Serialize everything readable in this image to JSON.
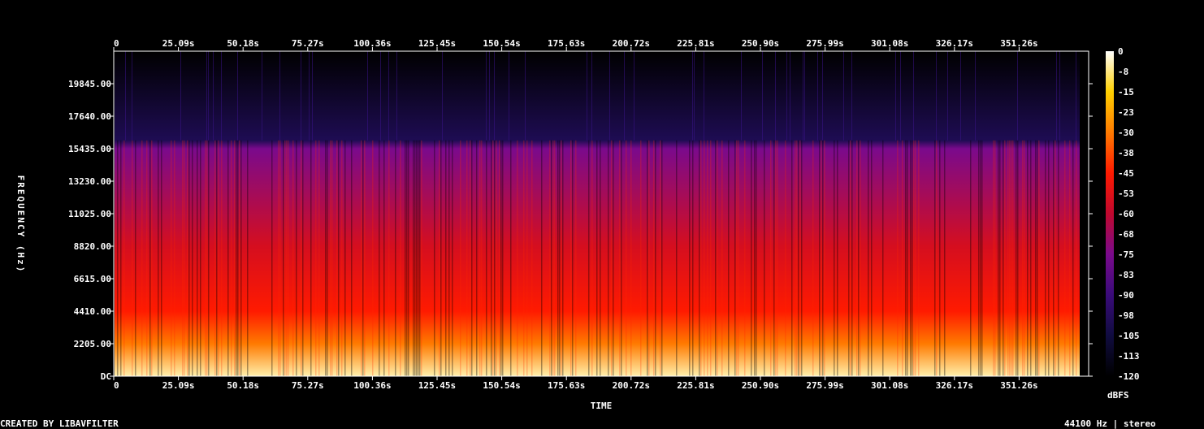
{
  "chart_data": {
    "type": "heatmap",
    "title": "",
    "xlabel": "TIME",
    "ylabel": "FREQUENCY (Hz)",
    "colorbar_label": "dBFS",
    "x_ticks": [
      "0",
      "25.09s",
      "50.18s",
      "75.27s",
      "100.36s",
      "125.45s",
      "150.54s",
      "175.63s",
      "200.72s",
      "225.81s",
      "250.90s",
      "275.99s",
      "301.08s",
      "326.17s",
      "351.26s"
    ],
    "y_ticks": [
      "DC",
      "2205.00",
      "4410.00",
      "6615.00",
      "8820.00",
      "11025.00",
      "13230.00",
      "15435.00",
      "17640.00",
      "19845.00"
    ],
    "colorbar_ticks": [
      "0",
      "-8",
      "-15",
      "-23",
      "-30",
      "-38",
      "-45",
      "-53",
      "-60",
      "-68",
      "-75",
      "-83",
      "-90",
      "-98",
      "-105",
      "-113",
      "-120"
    ],
    "xlim": [
      0,
      372
    ],
    "ylim": [
      0,
      22050
    ],
    "zlim": [
      -120,
      0
    ],
    "colormap_stops": [
      "#000000",
      "#100c40",
      "#3a0b7a",
      "#7a0a8c",
      "#c0082e",
      "#ff1a00",
      "#ff7a00",
      "#ffd000",
      "#ffffff"
    ],
    "energy_profile": {
      "bandwidth_cutoff_hz": 16000,
      "low_bands": [
        {
          "freq_hz": 0,
          "db": -5
        },
        {
          "freq_hz": 2205,
          "db": -30
        },
        {
          "freq_hz": 4410,
          "db": -45
        },
        {
          "freq_hz": 8820,
          "db": -55
        },
        {
          "freq_hz": 15435,
          "db": -75
        },
        {
          "freq_hz": 16000,
          "db": -100
        },
        {
          "freq_hz": 22050,
          "db": -120
        }
      ]
    }
  },
  "footer": {
    "created_by": "CREATED BY LIBAVFILTER",
    "info": "44100 Hz | stereo"
  }
}
